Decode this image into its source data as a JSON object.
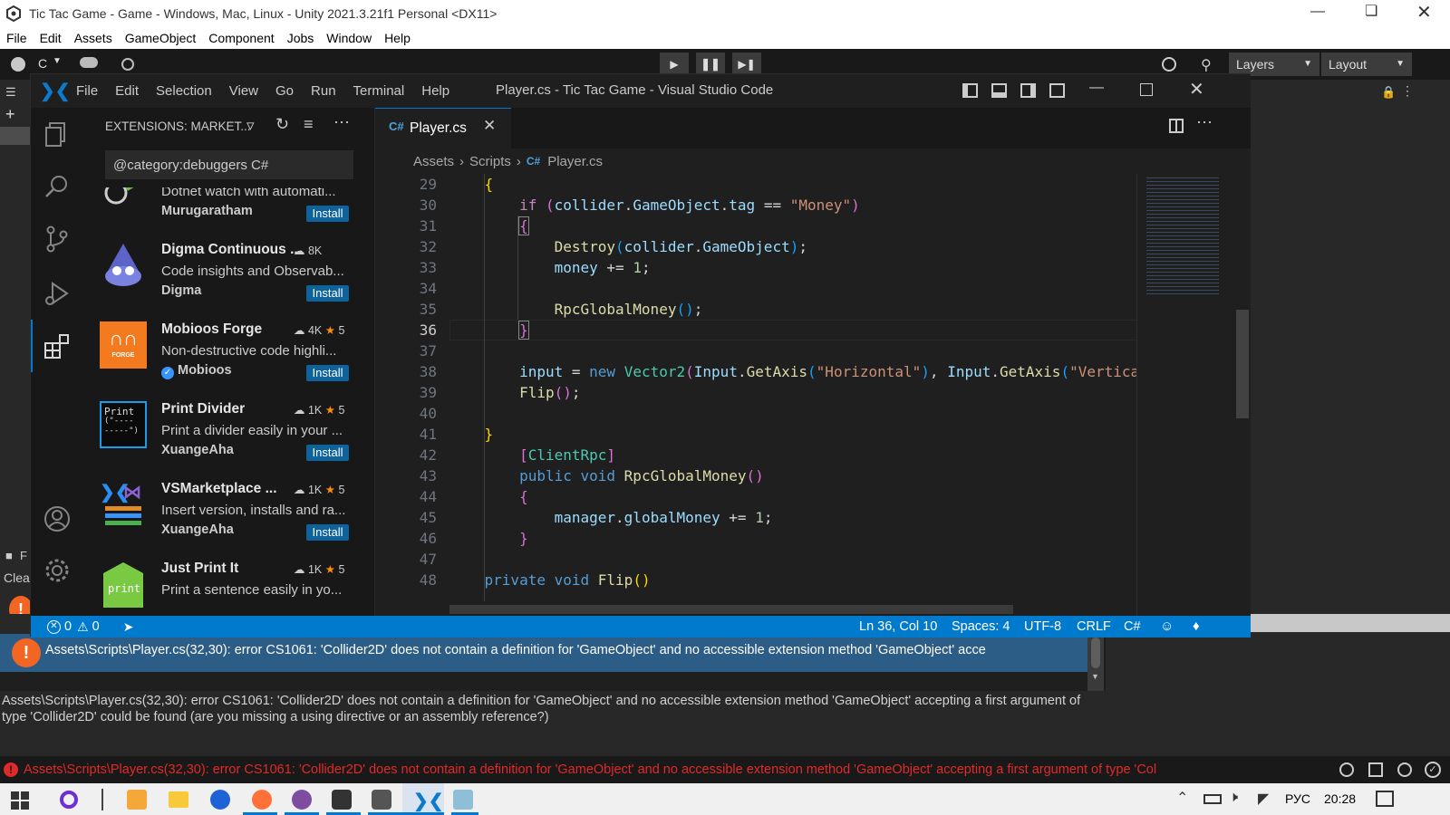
{
  "unity": {
    "title": "Tic Tac Game - Game - Windows, Mac, Linux - Unity 2021.3.21f1 Personal <DX11>",
    "menu": [
      "File",
      "Edit",
      "Assets",
      "GameObject",
      "Component",
      "Jobs",
      "Window",
      "Help"
    ],
    "account_label": "C",
    "layers_label": "Layers",
    "layout_label": "Layout",
    "left_panel_label_1": "F",
    "left_panel_label_2": "Clea",
    "console_error": "Assets\\Scripts\\Player.cs(32,30): error CS1061: 'Collider2D' does not contain a definition for 'GameObject' and no accessible extension method 'GameObject' accepting a first argument of type 'Collider2D' could be found (are you missing a using directive or an assembly reference?)",
    "console_error_short": "Assets\\Scripts\\Player.cs(32,30): error CS1061: 'Collider2D' does not contain a definition for 'GameObject' and no accessible extension method 'GameObject' acce",
    "status_error": "Assets\\Scripts\\Player.cs(32,30): error CS1061: 'Collider2D' does not contain a definition for 'GameObject' and no accessible extension method 'GameObject' accepting a first argument of type 'Col"
  },
  "vscode": {
    "menu": [
      "File",
      "Edit",
      "Selection",
      "View",
      "Go",
      "Run",
      "Terminal",
      "Help"
    ],
    "title": "Player.cs - Tic Tac Game - Visual Studio Code",
    "sidebar_title": "EXTENSIONS: MARKET...",
    "search_value": "@category:debuggers C#",
    "extensions": [
      {
        "title": "",
        "desc": "Dotnet watch with automati...",
        "publisher": "Murugaratham",
        "install": "Install",
        "installs": "",
        "stars": ""
      },
      {
        "title": "Digma Continuous ...",
        "desc": "Code insights and Observab...",
        "publisher": "Digma",
        "install": "Install",
        "installs": "8K",
        "stars": ""
      },
      {
        "title": "Mobioos Forge",
        "desc": "Non-destructive code highli...",
        "publisher": "Mobioos",
        "install": "Install",
        "installs": "4K",
        "stars": "5"
      },
      {
        "title": "Print Divider",
        "desc": "Print a divider easily in your ...",
        "publisher": "XuangeAha",
        "install": "Install",
        "installs": "1K",
        "stars": "5"
      },
      {
        "title": "VSMarketplace ...",
        "desc": "Insert version, installs and ra...",
        "publisher": "XuangeAha",
        "install": "Install",
        "installs": "1K",
        "stars": "5"
      },
      {
        "title": "Just Print It",
        "desc": "Print a sentence easily in yo...",
        "publisher": "",
        "install": "",
        "installs": "1K",
        "stars": "5"
      }
    ],
    "mobioos_icon_text": "FORGE",
    "print_icon_text": "Print",
    "print_icon_text2": "(\"----",
    "print_icon_text3": "-----\")",
    "justprint_icon_text": "print",
    "tab_label": "Player.cs",
    "breadcrumb": [
      "Assets",
      "Scripts",
      "Player.cs"
    ],
    "line_numbers": [
      "29",
      "30",
      "31",
      "32",
      "33",
      "34",
      "35",
      "36",
      "37",
      "38",
      "39",
      "40",
      "41",
      "42",
      "43",
      "44",
      "45",
      "46",
      "47",
      "48"
    ],
    "status": {
      "errors": "0",
      "warnings": "0",
      "position": "Ln 36, Col 10",
      "spaces": "Spaces: 4",
      "encoding": "UTF-8",
      "eol": "CRLF",
      "language": "C#"
    }
  },
  "taskbar": {
    "language": "РУС",
    "time": "20:28"
  },
  "colors": {
    "vscode_status": "#007acc",
    "install_button": "#0e639c",
    "error_red": "#e02a2a",
    "unity_error_icon": "#f26522"
  }
}
